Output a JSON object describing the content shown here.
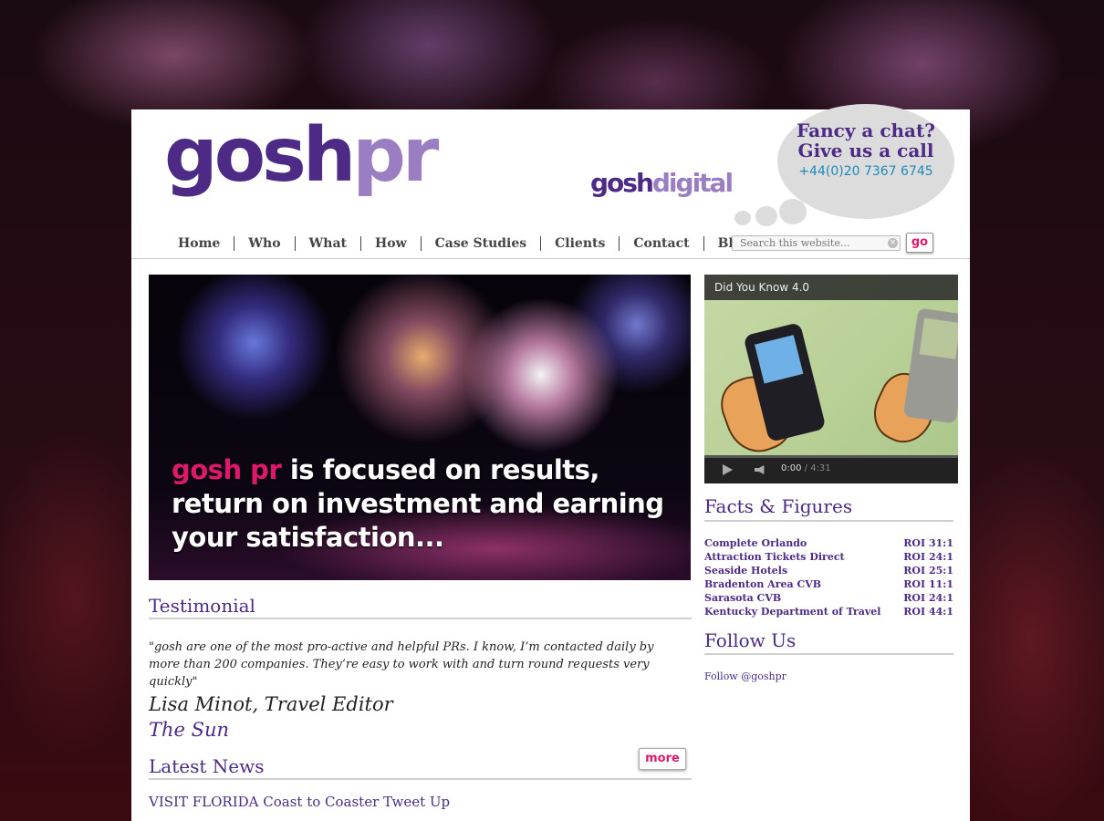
{
  "header": {
    "logo_part1": "gosh",
    "logo_part2": "pr",
    "digital_part1": "gosh",
    "digital_part2": "digital",
    "cta_line1": "Fancy a chat?",
    "cta_line2": "Give us a call",
    "phone": "+44(0)20 7367 6745"
  },
  "nav": [
    "Home",
    "Who",
    "What",
    "How",
    "Case Studies",
    "Clients",
    "Contact",
    "Blog"
  ],
  "search": {
    "placeholder": "Search this website...",
    "button": "go",
    "clear_icon": "×"
  },
  "hero": {
    "brand": "gosh pr",
    "line1_rest": " is focused on results,",
    "line2": "return on investment and earning",
    "line3": "your satisfaction..."
  },
  "video": {
    "title": "Did You Know 4.0",
    "time_current": "0:00",
    "time_total": "/ 4:31"
  },
  "testimonial": {
    "heading": "Testimonial",
    "quote": "\"gosh are one of the most pro-active and helpful PRs. I know, I’m contacted daily by more than 200 companies. They’re easy to work with and turn round requests very quickly\"",
    "person": "Lisa Minot, Travel Editor",
    "org": "The Sun"
  },
  "news": {
    "heading": "Latest News",
    "more": "more",
    "item": "VISIT FLORIDA Coast to Coaster Tweet Up"
  },
  "facts": {
    "heading": "Facts & Figures",
    "rows": [
      {
        "name": "Complete Orlando",
        "roi": "ROI 31:1"
      },
      {
        "name": "Attraction Tickets Direct",
        "roi": "ROI 24:1"
      },
      {
        "name": "Seaside Hotels",
        "roi": "ROI 25:1"
      },
      {
        "name": "Bradenton Area CVB",
        "roi": "ROI 11:1"
      },
      {
        "name": "Sarasota CVB",
        "roi": "ROI 24:1"
      },
      {
        "name": "Kentucky Department of Travel",
        "roi": "ROI 44:1"
      }
    ]
  },
  "follow": {
    "heading": "Follow Us",
    "link": "Follow @goshpr"
  },
  "colors": {
    "brand_purple": "#4d2a85",
    "brand_lavender": "#9b7dc2",
    "accent_pink": "#e0186d",
    "phone_blue": "#1e8ab8"
  }
}
